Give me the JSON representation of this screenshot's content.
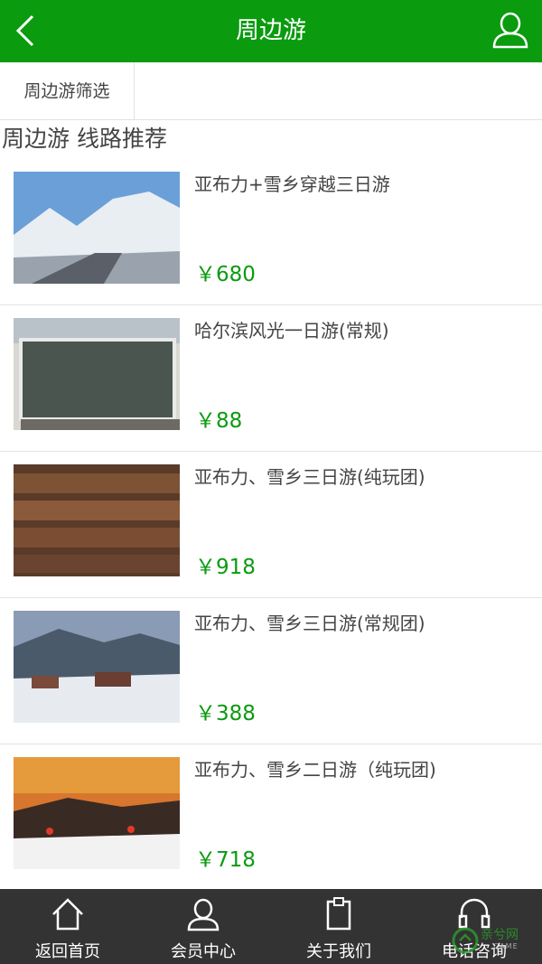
{
  "header": {
    "title": "周边游",
    "back_icon": "chevron-left-icon",
    "user_icon": "user-icon"
  },
  "filter": {
    "tab_label": "周边游筛选"
  },
  "section": {
    "title": "周边游 线路推荐"
  },
  "routes": [
    {
      "name": "亚布力+雪乡穿越三日游",
      "price": "￥680"
    },
    {
      "name": "哈尔滨风光一日游(常规)",
      "price": "￥88"
    },
    {
      "name": "亚布力、雪乡三日游(纯玩团)",
      "price": "￥918"
    },
    {
      "name": "亚布力、雪乡三日游(常规团)",
      "price": "￥388"
    },
    {
      "name": "亚布力、雪乡二日游（纯玩团)",
      "price": "￥718"
    }
  ],
  "tabbar": [
    {
      "label": "返回首页",
      "icon": "home-icon"
    },
    {
      "label": "会员中心",
      "icon": "user-icon"
    },
    {
      "label": "关于我们",
      "icon": "clipboard-icon"
    },
    {
      "label": "电话咨询",
      "icon": "headset-icon"
    }
  ],
  "watermark": {
    "text": "亲兮网",
    "sub": "GAME"
  },
  "colors": {
    "accent": "#0a9b0f",
    "tabbar_bg": "#333333"
  }
}
